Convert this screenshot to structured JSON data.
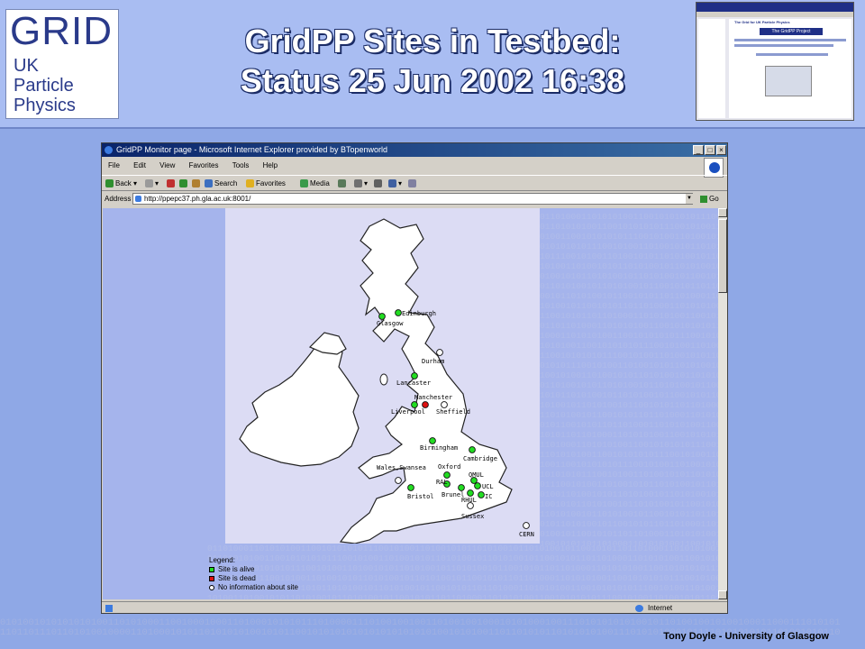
{
  "slide": {
    "logo": {
      "big": "GRID",
      "lines": [
        "UK",
        "Particle",
        "Physics"
      ]
    },
    "title_line1": "GridPP Sites in Testbed:",
    "title_line2": "Status 25 Jun 2002 16:38",
    "footer": "Tony Doyle - University of Glasgow",
    "binary_line1": "0101001010101010100110101000110010001000110100010101011101000011101001001001101001001000101010001001110101010101001011010010010100100011000111010101",
    "binary_line2": "1101101110110101001000011010001010110101010100101011001010101010101010101010100101010011011010101101010101001110101010001011110101010101101001010110"
  },
  "thumbnail": {
    "heading": "The Grid for UK Particle Physics",
    "project": "The GridPP Project"
  },
  "browser": {
    "title": "GridPP Monitor page - Microsoft Internet Explorer provided by BTopenworld",
    "menu": [
      "File",
      "Edit",
      "View",
      "Favorites",
      "Tools",
      "Help"
    ],
    "toolbar": {
      "back": "Back",
      "search": "Search",
      "favorites": "Favorites",
      "media": "Media"
    },
    "address_label": "Address",
    "address_value": "http://ppepc37.ph.gla.ac.uk:8001/",
    "go_label": "Go",
    "status_zone": "Internet",
    "accent": "#0a246a"
  },
  "map": {
    "status_colors": {
      "alive": "#22dd22",
      "dead": "#dd1111",
      "unknown": "#ffffff"
    },
    "sites": [
      {
        "name": "Glasgow",
        "status": "alive"
      },
      {
        "name": "Edinburgh",
        "status": "alive"
      },
      {
        "name": "Durham",
        "status": "unknown"
      },
      {
        "name": "Lancaster",
        "status": "alive"
      },
      {
        "name": "Manchester",
        "status": "dead"
      },
      {
        "name": "Liverpool",
        "status": "alive"
      },
      {
        "name": "Sheffield",
        "status": "unknown"
      },
      {
        "name": "Birmingham",
        "status": "alive"
      },
      {
        "name": "Cambridge",
        "status": "alive"
      },
      {
        "name": "Wales,Swansea",
        "status": "unknown"
      },
      {
        "name": "Oxford",
        "status": "alive"
      },
      {
        "name": "RAL",
        "status": "alive"
      },
      {
        "name": "QMUL",
        "status": "alive"
      },
      {
        "name": "UCL",
        "status": "alive"
      },
      {
        "name": "Bristol",
        "status": "alive"
      },
      {
        "name": "Brunel",
        "status": "alive"
      },
      {
        "name": "RHUL",
        "status": "alive"
      },
      {
        "name": "IC",
        "status": "alive"
      },
      {
        "name": "Sussex",
        "status": "unknown"
      },
      {
        "name": "CERN",
        "status": "unknown"
      }
    ]
  },
  "legend": {
    "title": "Legend:",
    "alive": "Site is alive",
    "dead": "Site is dead",
    "unknown": "No information about site"
  }
}
